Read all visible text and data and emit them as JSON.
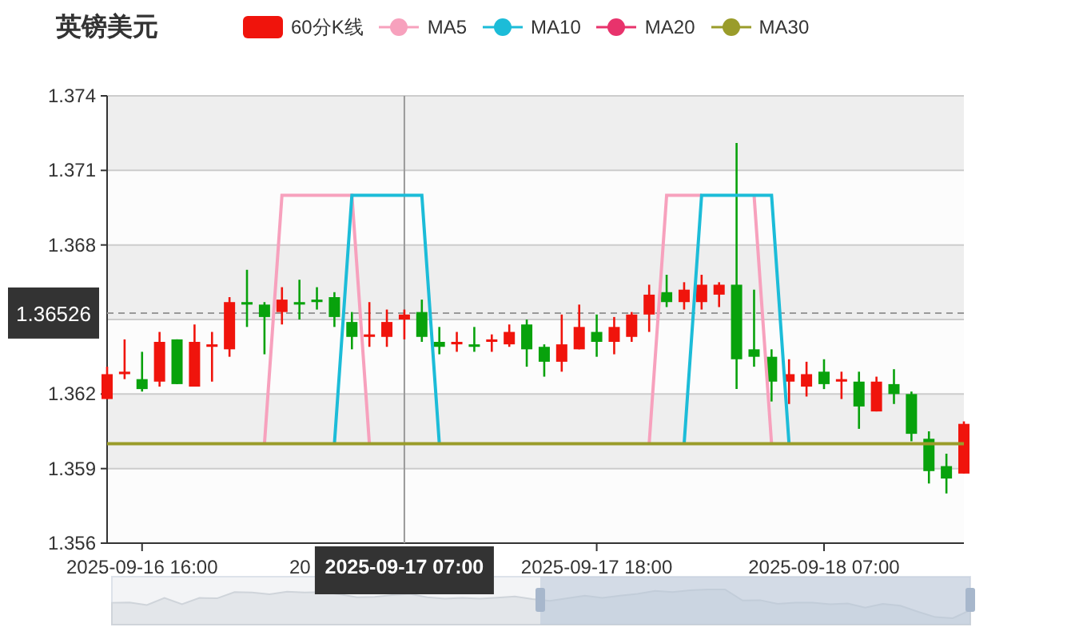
{
  "title": "英镑美元",
  "candle_legend": {
    "label": "60分K线"
  },
  "covered_axis_label": "20",
  "chart_data": {
    "type": "candlestick",
    "grid": true,
    "ylim": [
      1.356,
      1.374
    ],
    "yticks": [
      {
        "value": 1.356,
        "label": "1.356"
      },
      {
        "value": 1.359,
        "label": "1.359"
      },
      {
        "value": 1.362,
        "label": "1.362"
      },
      {
        "value": 1.368,
        "label": "1.368"
      },
      {
        "value": 1.371,
        "label": "1.371"
      },
      {
        "value": 1.374,
        "label": "1.374"
      }
    ],
    "categories": [
      null,
      null,
      "2025-09-16 16:00",
      null,
      null,
      null,
      null,
      null,
      null,
      null,
      null,
      null,
      null,
      null,
      null,
      null,
      null,
      "2025-09-17 07:00",
      null,
      null,
      null,
      null,
      null,
      null,
      null,
      null,
      null,
      null,
      "2025-09-17 18:00",
      null,
      null,
      null,
      null,
      null,
      null,
      null,
      null,
      null,
      null,
      null,
      null,
      "2025-09-18 07:00",
      null,
      null,
      null,
      null,
      null,
      null,
      null,
      null
    ],
    "ohlc": [
      [
        1.3618,
        1.3631,
        1.3618,
        1.3628
      ],
      [
        1.3628,
        1.3642,
        1.3626,
        1.3629
      ],
      [
        1.3626,
        1.3637,
        1.3621,
        1.3622
      ],
      [
        1.3625,
        1.3645,
        1.3623,
        1.3641
      ],
      [
        1.3642,
        1.3642,
        1.3624,
        1.3624
      ],
      [
        1.3623,
        1.3648,
        1.3623,
        1.3641
      ],
      [
        1.3639,
        1.3645,
        1.3625,
        1.364
      ],
      [
        1.3638,
        1.3659,
        1.3635,
        1.3657
      ],
      [
        1.3657,
        1.367,
        1.3647,
        1.3656
      ],
      [
        1.3656,
        1.3657,
        1.3636,
        1.3651
      ],
      [
        1.3653,
        1.3663,
        1.3648,
        1.3658
      ],
      [
        1.3657,
        1.3666,
        1.365,
        1.3656
      ],
      [
        1.3658,
        1.3663,
        1.3654,
        1.3657
      ],
      [
        1.3659,
        1.3661,
        1.3647,
        1.3651
      ],
      [
        1.3649,
        1.3653,
        1.3638,
        1.3643
      ],
      [
        1.3643,
        1.3657,
        1.3639,
        1.3644
      ],
      [
        1.3643,
        1.3654,
        1.3639,
        1.3649
      ],
      [
        1.365,
        1.3654,
        1.3642,
        1.3652
      ],
      [
        1.3653,
        1.3658,
        1.3641,
        1.3643
      ],
      [
        1.3641,
        1.3647,
        1.3636,
        1.3639
      ],
      [
        1.364,
        1.3645,
        1.3637,
        1.3641
      ],
      [
        1.364,
        1.3647,
        1.3637,
        1.3639
      ],
      [
        1.3641,
        1.3644,
        1.3637,
        1.3642
      ],
      [
        1.364,
        1.3648,
        1.3639,
        1.3645
      ],
      [
        1.3648,
        1.365,
        1.3631,
        1.3638
      ],
      [
        1.3639,
        1.364,
        1.3627,
        1.3633
      ],
      [
        1.3633,
        1.3652,
        1.3629,
        1.364
      ],
      [
        1.3638,
        1.3656,
        1.3638,
        1.3647
      ],
      [
        1.3645,
        1.3652,
        1.3635,
        1.3641
      ],
      [
        1.3641,
        1.3651,
        1.3636,
        1.3647
      ],
      [
        1.3643,
        1.3653,
        1.3641,
        1.3652
      ],
      [
        1.3652,
        1.3664,
        1.3645,
        1.366
      ],
      [
        1.3661,
        1.3668,
        1.3655,
        1.3657
      ],
      [
        1.3657,
        1.3665,
        1.3654,
        1.3662
      ],
      [
        1.3657,
        1.3668,
        1.3654,
        1.3664
      ],
      [
        1.366,
        1.3665,
        1.3655,
        1.3664
      ],
      [
        1.3664,
        1.3721,
        1.3622,
        1.3634
      ],
      [
        1.3638,
        1.3662,
        1.3631,
        1.3635
      ],
      [
        1.3635,
        1.3638,
        1.3617,
        1.3625
      ],
      [
        1.3625,
        1.3634,
        1.3616,
        1.3628
      ],
      [
        1.3623,
        1.3633,
        1.3619,
        1.3628
      ],
      [
        1.3629,
        1.3634,
        1.3622,
        1.3624
      ],
      [
        1.3625,
        1.3629,
        1.3618,
        1.3626
      ],
      [
        1.3625,
        1.3629,
        1.3606,
        1.3615
      ],
      [
        1.3613,
        1.3627,
        1.3613,
        1.3625
      ],
      [
        1.3624,
        1.363,
        1.3616,
        1.362
      ],
      [
        1.362,
        1.3621,
        1.3601,
        1.3604
      ],
      [
        1.3602,
        1.3605,
        1.3584,
        1.3589
      ],
      [
        1.3591,
        1.3596,
        1.358,
        1.3586
      ],
      [
        1.3588,
        1.3609,
        1.3588,
        1.3608
      ]
    ],
    "series": [
      {
        "name": "MA5",
        "type": "line",
        "color": "#f7a1bd",
        "values": [
          null,
          null,
          null,
          null,
          null,
          null,
          null,
          null,
          null,
          1.36,
          1.37,
          1.37,
          1.37,
          1.37,
          1.37,
          1.36,
          null,
          null,
          null,
          null,
          null,
          null,
          null,
          null,
          null,
          null,
          null,
          null,
          null,
          null,
          null,
          1.36,
          1.37,
          1.37,
          1.37,
          null,
          null,
          1.37,
          1.36,
          null,
          null,
          null,
          null,
          null,
          null,
          null,
          null,
          null,
          null,
          null
        ]
      },
      {
        "name": "MA10",
        "type": "line",
        "color": "#1cbcd8",
        "values": [
          null,
          null,
          null,
          null,
          null,
          null,
          null,
          null,
          null,
          null,
          null,
          null,
          null,
          1.36,
          1.37,
          1.37,
          1.37,
          1.37,
          1.37,
          1.36,
          null,
          null,
          null,
          null,
          null,
          null,
          null,
          null,
          null,
          null,
          null,
          null,
          null,
          1.36,
          1.37,
          1.37,
          1.37,
          1.37,
          1.37,
          1.36,
          null,
          null,
          null,
          null,
          null,
          null,
          null,
          null,
          null,
          null
        ]
      },
      {
        "name": "MA20",
        "type": "line",
        "color": "#e8336c",
        "values": [
          null,
          null,
          null,
          null,
          null,
          null,
          null,
          null,
          null,
          null,
          null,
          null,
          null,
          null,
          null,
          null,
          null,
          null,
          null,
          null,
          null,
          null,
          null,
          null,
          null,
          null,
          null,
          null,
          null,
          null,
          null,
          null,
          null,
          null,
          null,
          null,
          null,
          null,
          null,
          null,
          null,
          null,
          null,
          null,
          null,
          null,
          null,
          null,
          null,
          null
        ]
      },
      {
        "name": "MA30",
        "type": "line",
        "color": "#9a9c2a",
        "values": [
          1.36,
          1.36,
          1.36,
          1.36,
          1.36,
          1.36,
          1.36,
          1.36,
          1.36,
          1.36,
          1.36,
          1.36,
          1.36,
          1.36,
          1.36,
          1.36,
          1.36,
          1.36,
          1.36,
          1.36,
          1.36,
          1.36,
          1.36,
          1.36,
          1.36,
          1.36,
          1.36,
          1.36,
          1.36,
          1.36,
          1.36,
          1.36,
          1.36,
          1.36,
          1.36,
          1.36,
          1.36,
          1.36,
          1.36,
          1.36,
          1.36,
          1.36,
          1.36,
          1.36,
          1.36,
          1.36,
          1.36,
          1.36,
          1.36,
          1.36
        ]
      }
    ],
    "bands": [
      {
        "axis": "y",
        "from": 1.371,
        "to": 1.374
      },
      {
        "axis": "y",
        "from": 1.365,
        "to": 1.368
      },
      {
        "axis": "y",
        "from": 1.359,
        "to": 1.362
      }
    ],
    "ref_lines": [
      {
        "axis": "y",
        "value": 1.36526,
        "label": "1.36526"
      },
      {
        "axis": "x",
        "value": "2025-09-17 07:00"
      }
    ]
  }
}
